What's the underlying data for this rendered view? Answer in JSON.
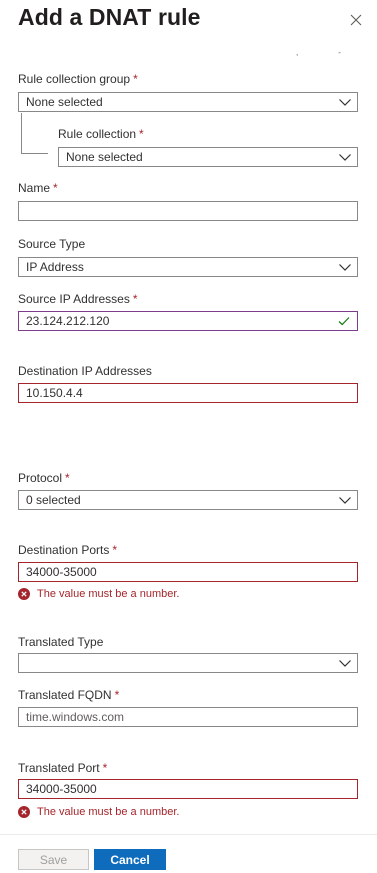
{
  "panel": {
    "title": "Add a DNAT rule",
    "close_icon": "close-icon"
  },
  "form": {
    "rule_collection_group": {
      "label": "Rule collection group",
      "required_mark": "*",
      "value": "None selected"
    },
    "rule_collection": {
      "label": "Rule collection",
      "required_mark": "*",
      "value": "None selected"
    },
    "name": {
      "label": "Name",
      "required_mark": "*",
      "value": ""
    },
    "source_type": {
      "label": "Source Type",
      "value": "IP Address"
    },
    "source_ip_addresses": {
      "label": "Source IP Addresses",
      "required_mark": "*",
      "value": "23.124.212.120",
      "status_icon": "checkmark-icon"
    },
    "destination_ip_addresses": {
      "label": "Destination IP Addresses",
      "value": "10.150.4.4"
    },
    "protocol": {
      "label": "Protocol",
      "required_mark": "*",
      "value": "0 selected"
    },
    "destination_ports": {
      "label": "Destination Ports",
      "required_mark": "*",
      "value": "34000-35000",
      "error": "The value must be a number."
    },
    "translated_type": {
      "label": "Translated Type",
      "value": ""
    },
    "translated_fqdn": {
      "label": "Translated FQDN",
      "required_mark": "*",
      "value": "time.windows.com"
    },
    "translated_port": {
      "label": "Translated Port",
      "required_mark": "*",
      "value": "34000-35000",
      "error": "The value must be a number."
    }
  },
  "footer": {
    "save_label": "Save",
    "cancel_label": "Cancel"
  },
  "colors": {
    "accent": "#0f6cbd",
    "error": "#a4262c",
    "valid_check": "#107c10"
  }
}
